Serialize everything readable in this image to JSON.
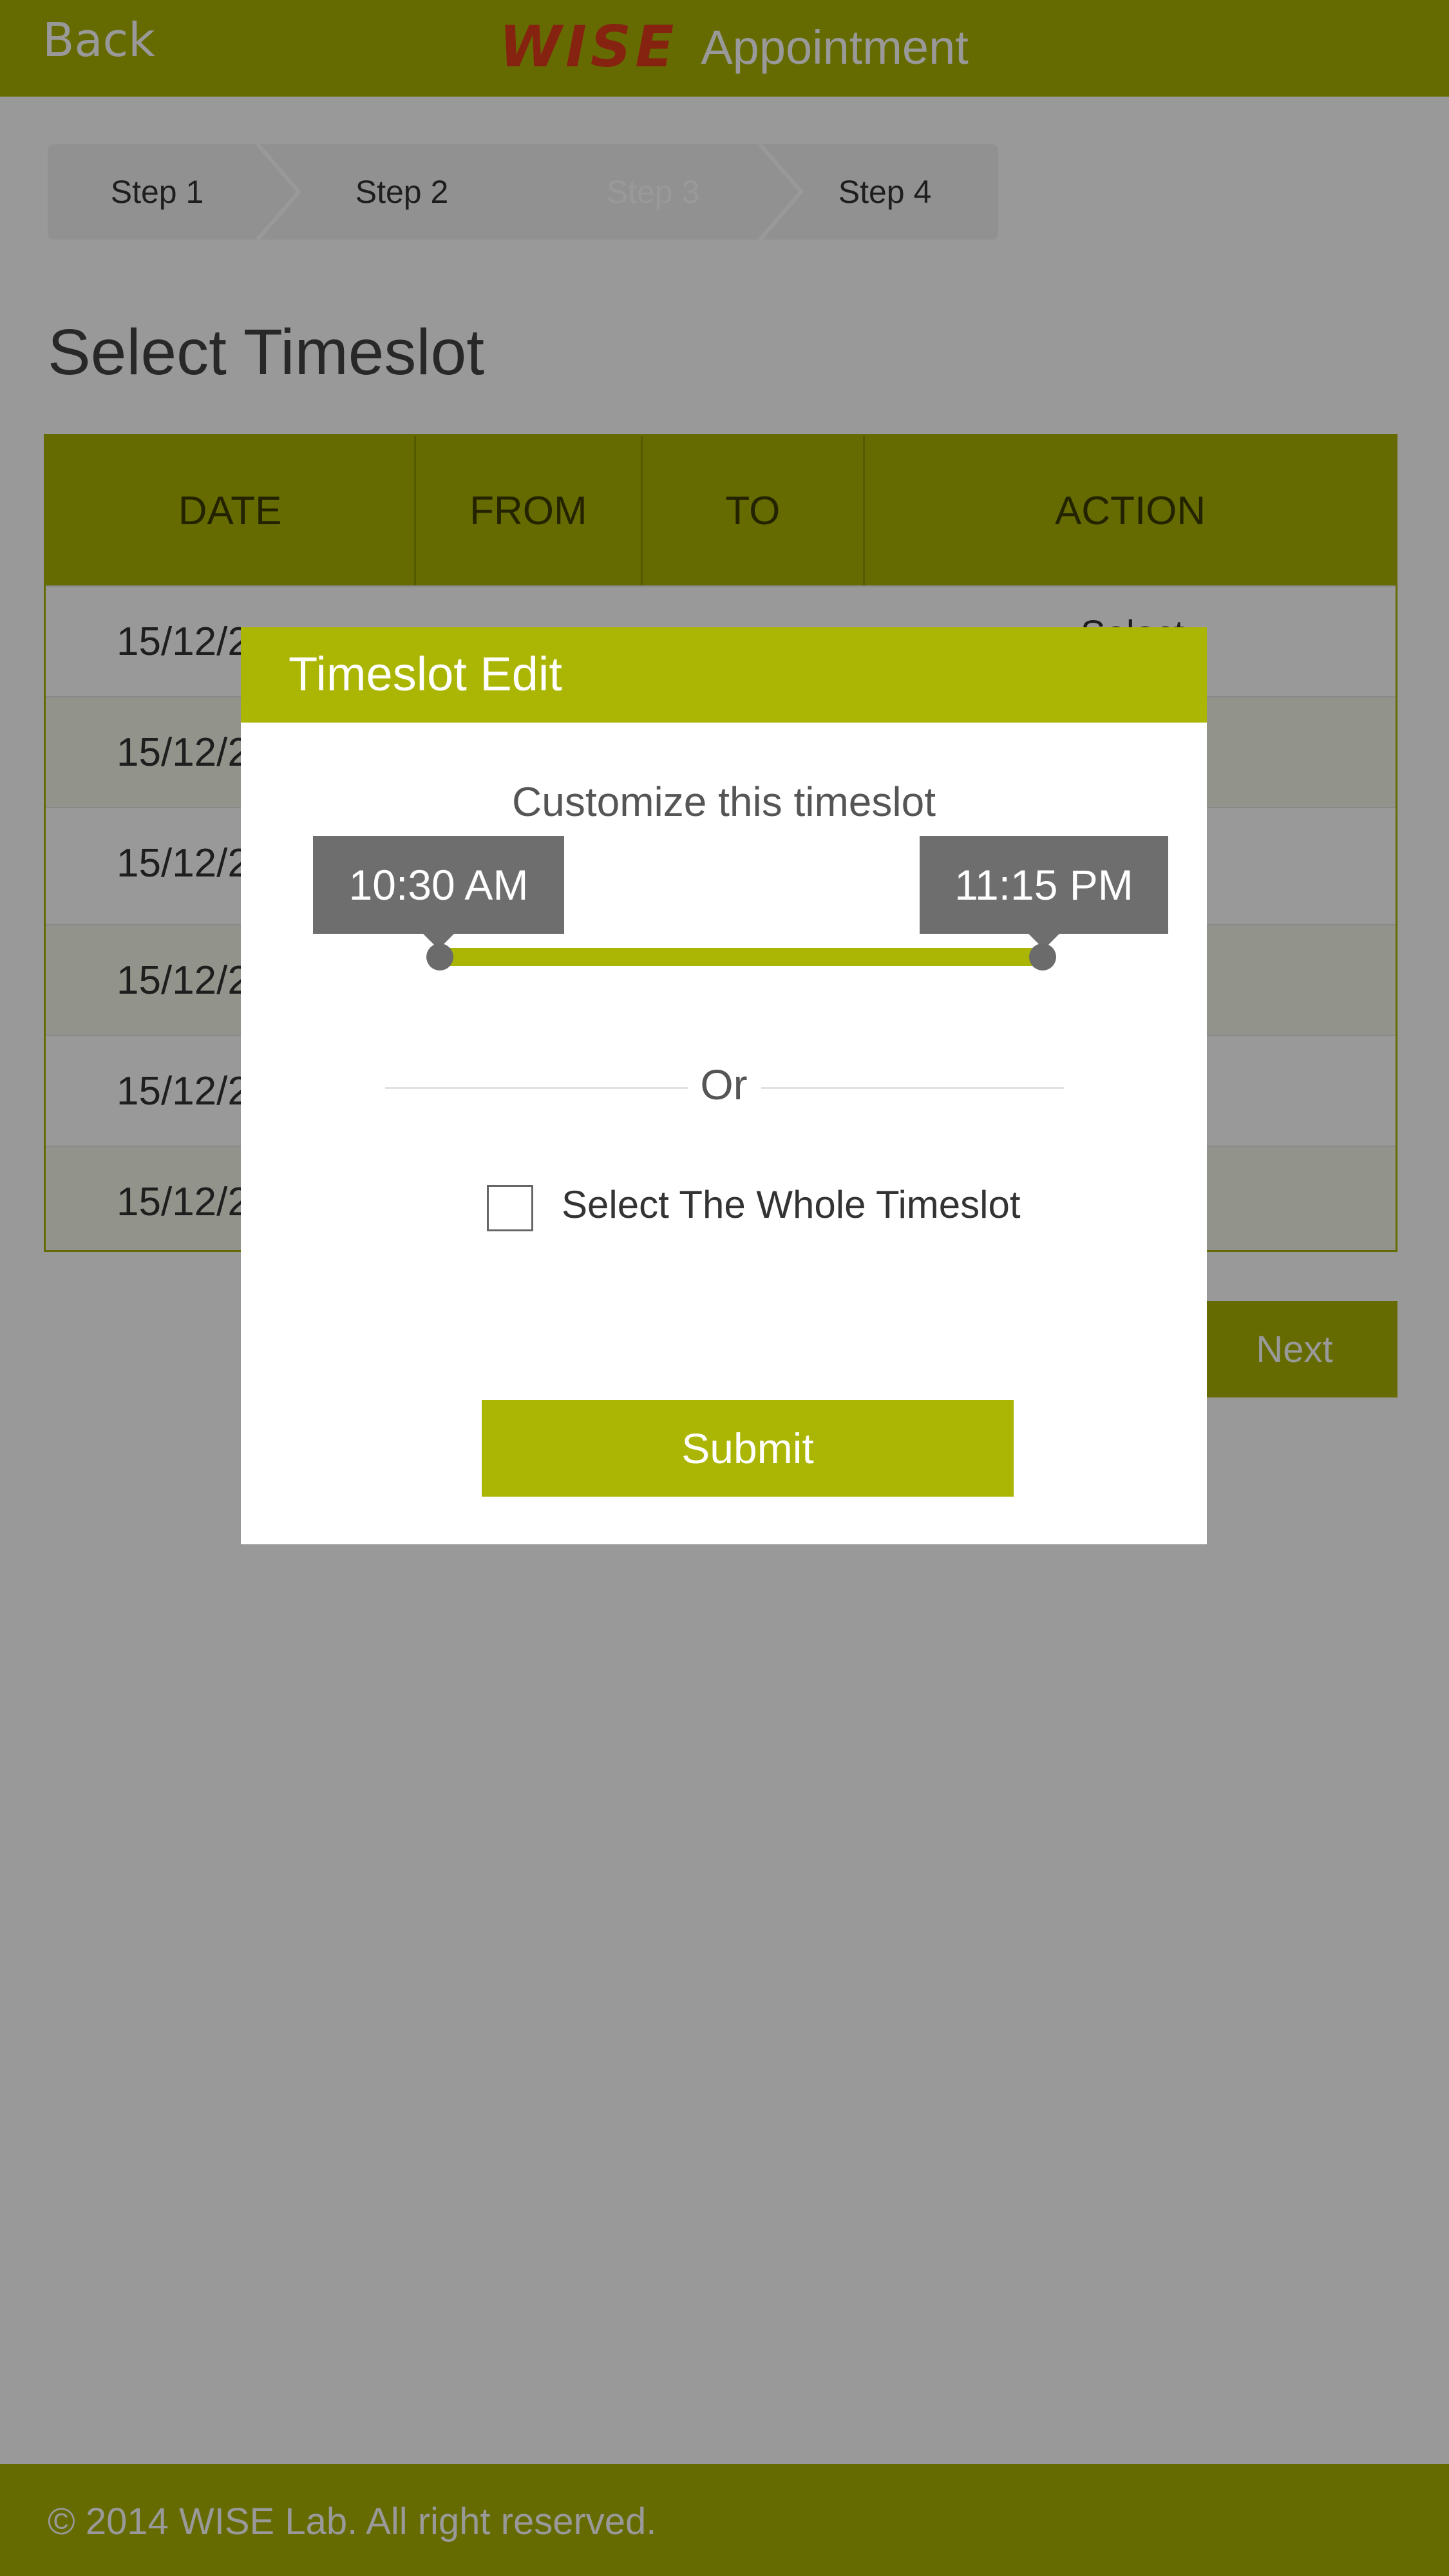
{
  "header": {
    "back_label": "Back",
    "logo_text": "WISE",
    "title": "Appointment"
  },
  "stepper": {
    "steps": [
      "Step 1",
      "Step 2",
      "Step 3",
      "Step 4"
    ],
    "active_step": 3
  },
  "page_title": "Select Timeslot",
  "table": {
    "headers": [
      "DATE",
      "FROM",
      "TO",
      "ACTION"
    ],
    "rows": [
      {
        "date": "15/12/2",
        "action": "Select"
      },
      {
        "date": "15/12/2",
        "action": ""
      },
      {
        "date": "15/12/2",
        "action": ""
      },
      {
        "date": "15/12/2",
        "action": ""
      },
      {
        "date": "15/12/2",
        "action": ""
      },
      {
        "date": "15/12/2",
        "action": ""
      }
    ]
  },
  "next_label": "Next",
  "footer": {
    "copyright": "© 2014 WISE Lab. All right reserved."
  },
  "modal": {
    "title": "Timeslot Edit",
    "subtitle": "Customize this timeslot",
    "slider": {
      "start_label": "10:30 AM",
      "end_label": "11:15 PM"
    },
    "or_label": "Or",
    "whole_timeslot_label": "Select The Whole Timeslot",
    "whole_timeslot_checked": false,
    "submit_label": "Submit"
  },
  "colors": {
    "accent": "#abb503",
    "brand_logo": "#e03a1c",
    "tooltip": "#6e6e6e"
  }
}
